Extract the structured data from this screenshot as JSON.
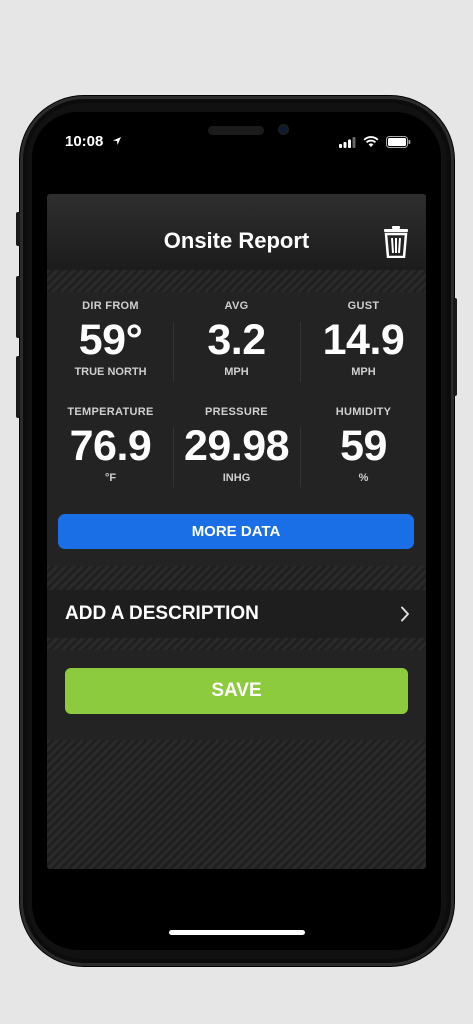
{
  "status": {
    "time": "10:08"
  },
  "header": {
    "title": "Onsite Report"
  },
  "stats": [
    {
      "label": "DIR FROM",
      "value": "59°",
      "unit": "TRUE NORTH"
    },
    {
      "label": "AVG",
      "value": "3.2",
      "unit": "MPH"
    },
    {
      "label": "GUST",
      "value": "14.9",
      "unit": "MPH"
    },
    {
      "label": "TEMPERATURE",
      "value": "76.9",
      "unit": "°F"
    },
    {
      "label": "PRESSURE",
      "value": "29.98",
      "unit": "INHG"
    },
    {
      "label": "HUMIDITY",
      "value": "59",
      "unit": "%"
    }
  ],
  "buttons": {
    "more_data": "MORE DATA",
    "save": "SAVE"
  },
  "description": {
    "label": "ADD A DESCRIPTION"
  },
  "colors": {
    "more_data": "#1a6fe6",
    "save": "#8bcb3d",
    "panel": "#232323"
  },
  "icons": [
    "location-arrow-icon",
    "signal-icon",
    "wifi-icon",
    "battery-icon",
    "trash-icon",
    "chevron-right-icon"
  ]
}
